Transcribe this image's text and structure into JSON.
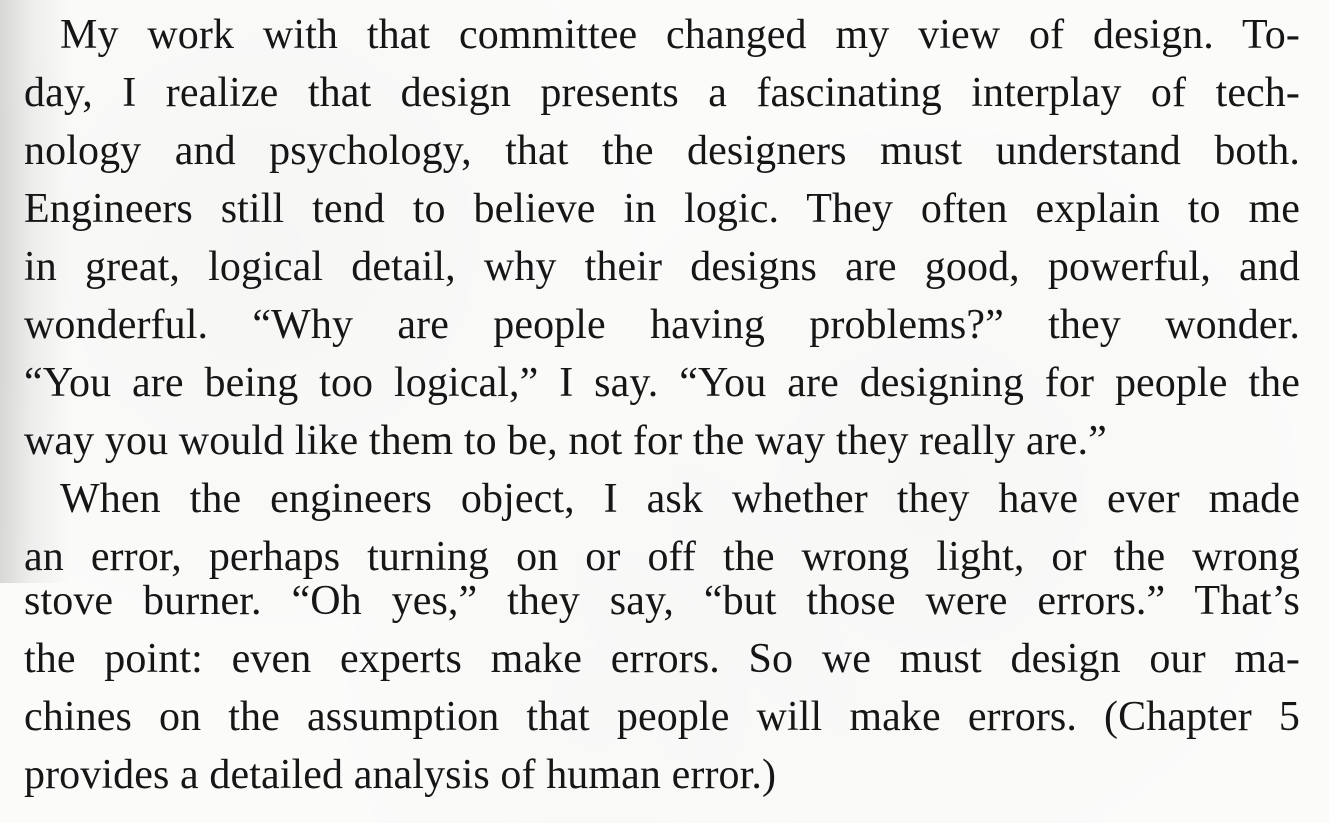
{
  "document": {
    "paragraph_1": [
      "My work with that committee changed my view of design. To-",
      "day, I realize that design presents a fascinating interplay of tech-",
      "nology and psychology, that the designers must understand both.",
      "Engineers still tend to believe in logic. They often explain to me",
      "in great, logical detail, why their designs are good, powerful, and",
      "wonderful. “Why are people having problems?” they wonder.",
      "“You are being too logical,” I say. “You are designing for people the",
      "way you would like them to be, not for the way they really are.”"
    ],
    "paragraph_2": [
      "When the engineers object, I ask whether they have ever made",
      "an error, perhaps turning on or off the wrong light, or the wrong",
      "stove burner. “Oh yes,” they say, “but those were errors.” That’s",
      "the point: even experts make errors. So we must design our ma-",
      "chines on the assumption that people will make errors. (Chapter 5",
      "provides a detailed analysis of human error.)"
    ]
  }
}
